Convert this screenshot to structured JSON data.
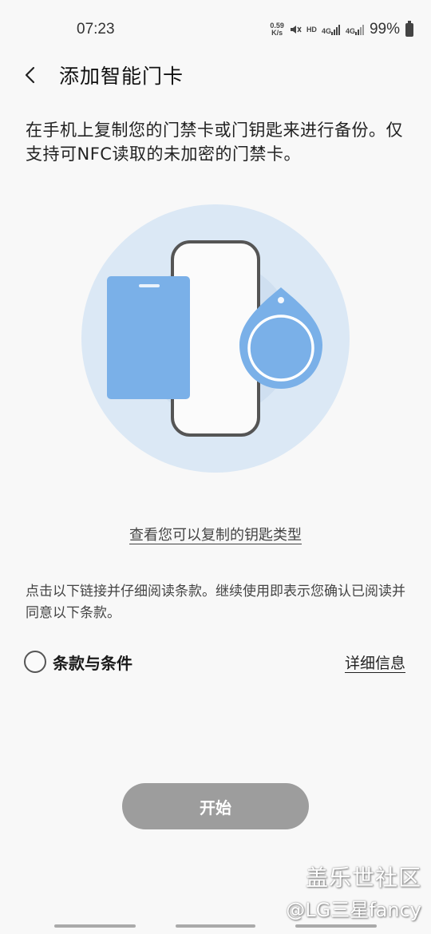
{
  "status_bar": {
    "time": "07:23",
    "net_speed_value": "0.59",
    "net_speed_unit": "K/s",
    "hd": "HD",
    "signal1": "4G",
    "signal2": "4G",
    "battery": "99%"
  },
  "header": {
    "title": "添加智能门卡"
  },
  "main": {
    "description": "在手机上复制您的门禁卡或门钥匙来进行备份。仅支持可NFC读取的未加密的门禁卡。",
    "key_types_link": "查看您可以复制的钥匙类型",
    "terms_text": "点击以下链接并仔细阅读条款。继续使用即表示您确认已阅读并同意以下条款。",
    "terms_label": "条款与条件",
    "details_link": "详细信息",
    "start_button": "开始"
  },
  "watermark": {
    "line1": "盖乐世社区",
    "line2": "@LG三星fancy"
  },
  "colors": {
    "background": "#f8f8f8",
    "illustration_circle": "#dbe8f5",
    "card": "#7ab0e8",
    "start_button": "#9d9d9d"
  }
}
